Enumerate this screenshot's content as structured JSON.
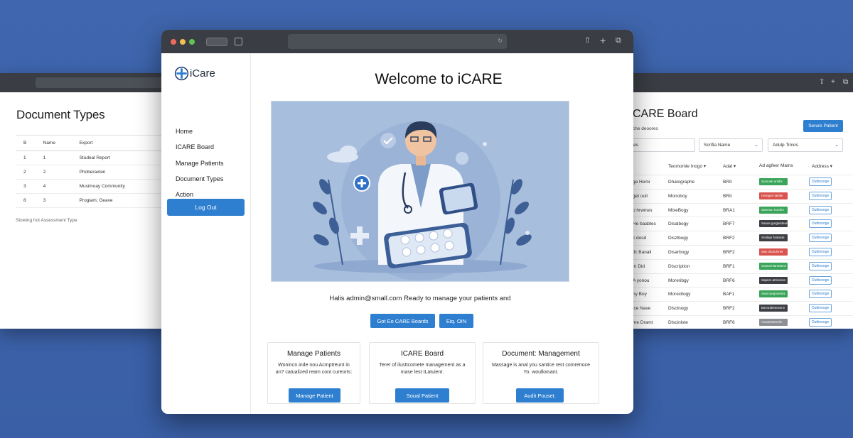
{
  "left_window": {
    "title": "Document Types",
    "columns": [
      "B",
      "Name",
      "Export"
    ],
    "rows": [
      [
        "1",
        "1",
        "Studeal Report"
      ],
      [
        "2",
        "2",
        "Phoberaxten"
      ],
      [
        "3",
        "4",
        "Musimoay Community"
      ],
      [
        "8",
        "3",
        "Progiam, Geave"
      ]
    ],
    "note": "Stowing hot Assessment Type"
  },
  "right_window": {
    "title": "CARE Board",
    "subtitle": "che deoores",
    "add_button": "Serure Patient",
    "filters": [
      {
        "label": "ebiles",
        "has_chevron": false
      },
      {
        "label": "Scrifia Name",
        "has_chevron": true
      },
      {
        "label": "Adulp Timos",
        "has_chevron": true
      }
    ],
    "columns": [
      "Teomomle Inogo ▾",
      "Adal ▾",
      "Ad agfeer Mams",
      "Address ▾"
    ],
    "rows": [
      {
        "name": "ge Hemi",
        "type": "Dhalographe",
        "code": "BRII",
        "tag_color": "#3aa55a",
        "tag_text": "Sumoek antibs",
        "action": "Outtinooge"
      },
      {
        "name": "get oull",
        "type": "Monoboy",
        "code": "BRII",
        "tag_color": "#d9534f",
        "tag_text": "Hareget nabilie",
        "action": "Outtinooge"
      },
      {
        "name": "o hrwnws",
        "type": "MixeBogy",
        "code": "BRA1",
        "tag_color": "#3aa55a",
        "tag_text": "Sancsa rrsscles",
        "action": "Outtinooge"
      },
      {
        "name": "He baables",
        "type": "Disalbogy",
        "code": "BRF7",
        "tag_color": "#3d3f44",
        "tag_text": "Sauas gurgaisteon",
        "action": "Outtinooge"
      },
      {
        "name": "c dosd",
        "type": "Diszlbogy",
        "code": "BRF2",
        "tag_color": "#3d3f44",
        "tag_text": "Snnlepr fotesste",
        "action": "Outtinooge"
      },
      {
        "name": "Jc Banall",
        "type": "Disarbogy",
        "code": "BRF2",
        "tag_color": "#d9534f",
        "tag_text": "Sae dnandirnet",
        "action": "Outtinooge"
      },
      {
        "name": "m Did",
        "type": "Discription",
        "code": "BRF1",
        "tag_color": "#3aa55a",
        "tag_text": "Soasarnlarasteon",
        "action": "Outtinooge"
      },
      {
        "name": "A yonou",
        "type": "Moreribgy",
        "code": "BRF6",
        "tag_color": "#3d3f44",
        "tag_text": "Sapnrs atrineess",
        "action": "Outtinooge"
      },
      {
        "name": "ny Boy",
        "type": "Morecllogy",
        "code": "BAF1",
        "tag_color": "#3aa55a",
        "tag_text": "Saurcaegmentra",
        "action": "Outtinooge"
      },
      {
        "name": "ice Nave",
        "type": "Dlsclnogy",
        "code": "BRF2",
        "tag_color": "#3d3f44",
        "tag_text": "Bsvoralentssenn",
        "action": "Outtinooge"
      },
      {
        "name": "me Dramt",
        "type": "Dlscinlste",
        "code": "BRF6",
        "tag_color": "#8c8f94",
        "tag_text": "Aosvtsntenelm",
        "action": "Outtinooge"
      }
    ]
  },
  "main_window": {
    "brand": "iCare",
    "nav": [
      "Home",
      "ICARE Board",
      "Manage Patients",
      "Document Types",
      "Action"
    ],
    "logout": "Log  Out",
    "heading": "Welcome to iCARE",
    "greeting": "Halis  admin@small.com Ready to manage your patients and",
    "buttons": {
      "primary": "Got Eo CARE Boards",
      "secondary": "Eiq. OIN"
    },
    "cards": [
      {
        "title": "Manage Patients",
        "text": "Wonincn.inde nou Acmptreunt in an? catualized ream cont cureorts:",
        "button": "Manage Patient"
      },
      {
        "title": "ICARE Board",
        "text": "Terer of ilusttcomete management as a mase lest tLatuient.",
        "button": "Soual Patient"
      },
      {
        "title": "Document: Management",
        "text": "Massage is anal you santice rest comrenoce Yo. woullomant.",
        "button": "Audit Pouset."
      }
    ]
  },
  "colors": {
    "accent": "#2f7fd0",
    "background": "#3f66ae",
    "chrome": "#3a3d43",
    "hero_bg": "#a8bedd"
  }
}
